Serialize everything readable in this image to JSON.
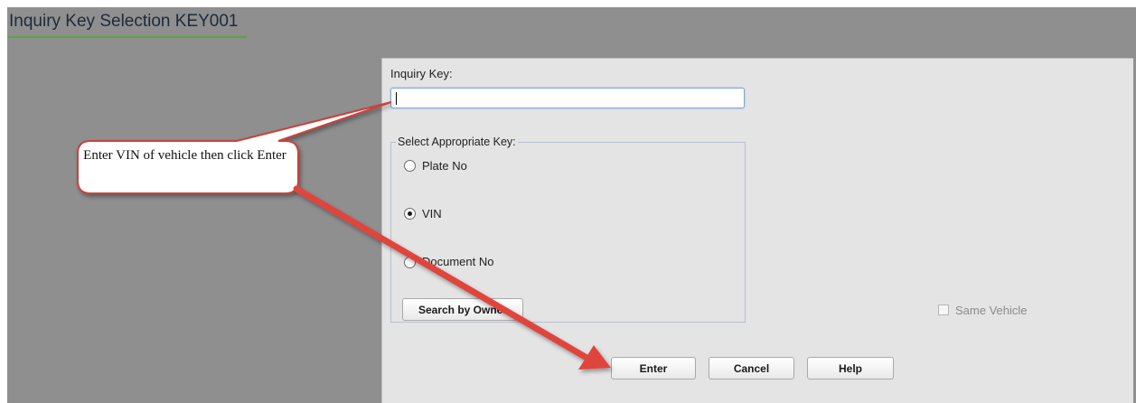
{
  "window": {
    "title": "Inquiry Key Selection KEY001"
  },
  "form": {
    "inquiry_key_label": "Inquiry Key:",
    "inquiry_key_value": "",
    "select_key_legend": "Select Appropriate Key:",
    "options": [
      {
        "label": "Plate No",
        "selected": false
      },
      {
        "label": "VIN",
        "selected": true
      },
      {
        "label": "Document No",
        "selected": false
      }
    ],
    "search_by_owner_label": "Search by Owner",
    "same_vehicle_label": "Same Vehicle",
    "same_vehicle_checked": false
  },
  "buttons": {
    "enter": "Enter",
    "cancel": "Cancel",
    "help": "Help"
  },
  "annotation": {
    "callout_text": "Enter VIN of vehicle then click Enter",
    "arrow_color": "#e0453d"
  },
  "colors": {
    "window_background": "#8f8f8f",
    "panel_background": "#e4e4e4",
    "title_underline": "#5aa640",
    "input_focus_border": "#7fa6d9"
  }
}
